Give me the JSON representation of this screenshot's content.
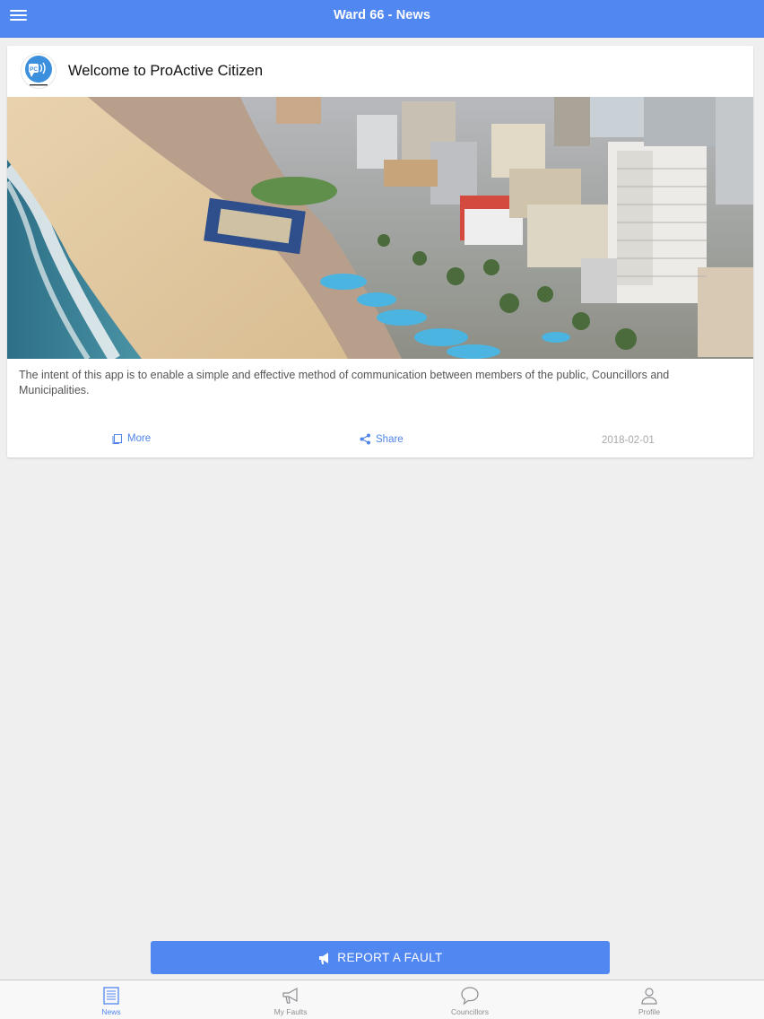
{
  "header": {
    "title": "Ward 66 - News",
    "menu_icon": "hamburger-menu-icon"
  },
  "colors": {
    "primary": "#5187f0",
    "background": "#efefef",
    "date_text": "#a8a8a8"
  },
  "news": [
    {
      "title": "Welcome to ProActive Citizen",
      "logo_icon": "proactive-citizen-logo",
      "logo_text": "PC",
      "image": "aerial-photo-durban-beachfront",
      "description": "The intent of this app is to enable a simple and effective method of communication between members of the public, Councillors and Municipalities.",
      "more_label": "More",
      "share_label": "Share",
      "date": "2018-02-01"
    }
  ],
  "report_button": {
    "label": "REPORT A FAULT",
    "icon": "megaphone-icon"
  },
  "tabbar": {
    "items": [
      {
        "label": "News",
        "icon": "newspaper-icon",
        "active": true
      },
      {
        "label": "My Faults",
        "icon": "megaphone-icon",
        "active": false
      },
      {
        "label": "Councillors",
        "icon": "chat-bubble-icon",
        "active": false
      },
      {
        "label": "Profile",
        "icon": "person-icon",
        "active": false
      }
    ]
  }
}
